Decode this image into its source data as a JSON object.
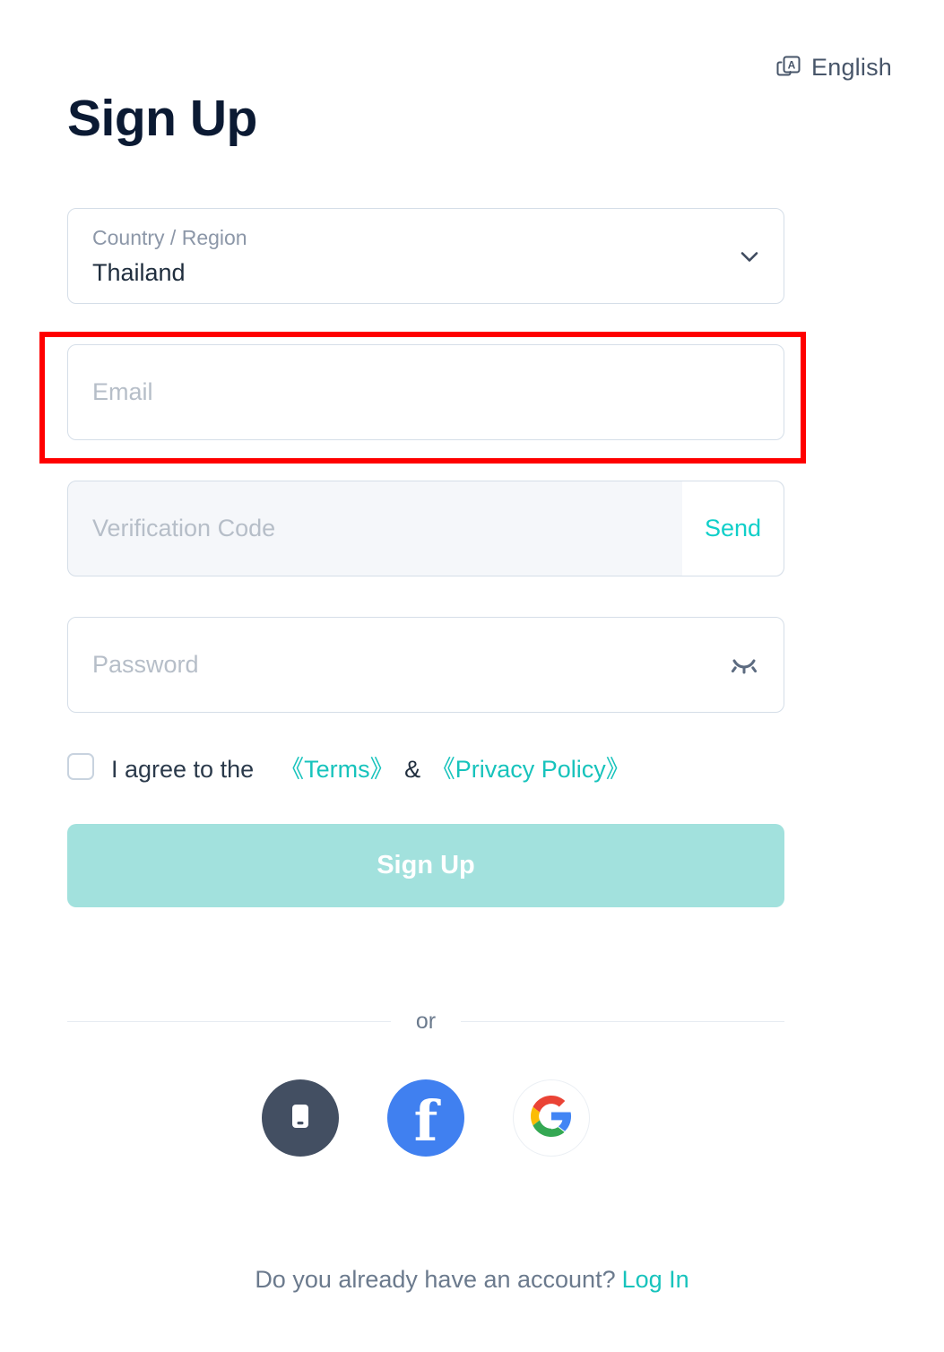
{
  "language_selector": {
    "icon": "translate-icon",
    "label": "English"
  },
  "page_title": "Sign Up",
  "form": {
    "country": {
      "label": "Country / Region",
      "value": "Thailand",
      "icon": "chevron-down-icon"
    },
    "email": {
      "placeholder": "Email"
    },
    "verification_code": {
      "placeholder": "Verification Code",
      "send_label": "Send"
    },
    "password": {
      "placeholder": "Password",
      "icon": "eye-off-icon"
    },
    "agreement": {
      "checked": false,
      "prefix": "I agree to the",
      "terms_link": "《Terms》",
      "separator": "&",
      "privacy_link": "《Privacy Policy》"
    },
    "submit_label": "Sign Up"
  },
  "divider_label": "or",
  "social_logins": [
    {
      "name": "mobile",
      "icon": "mobile-phone-icon"
    },
    {
      "name": "facebook",
      "icon": "facebook-icon",
      "glyph": "f"
    },
    {
      "name": "google",
      "icon": "google-icon"
    }
  ],
  "footer": {
    "text": "Do you already have an account?",
    "login_label": "Log In"
  },
  "colors": {
    "accent_teal": "#17C3BC",
    "send_teal": "#10CFC9",
    "button_disabled": "#A2E1DD",
    "title_navy": "#0B1A33",
    "annotation_red": "#FF0000",
    "facebook_blue": "#4080F0",
    "mobile_slate": "#434F62"
  }
}
